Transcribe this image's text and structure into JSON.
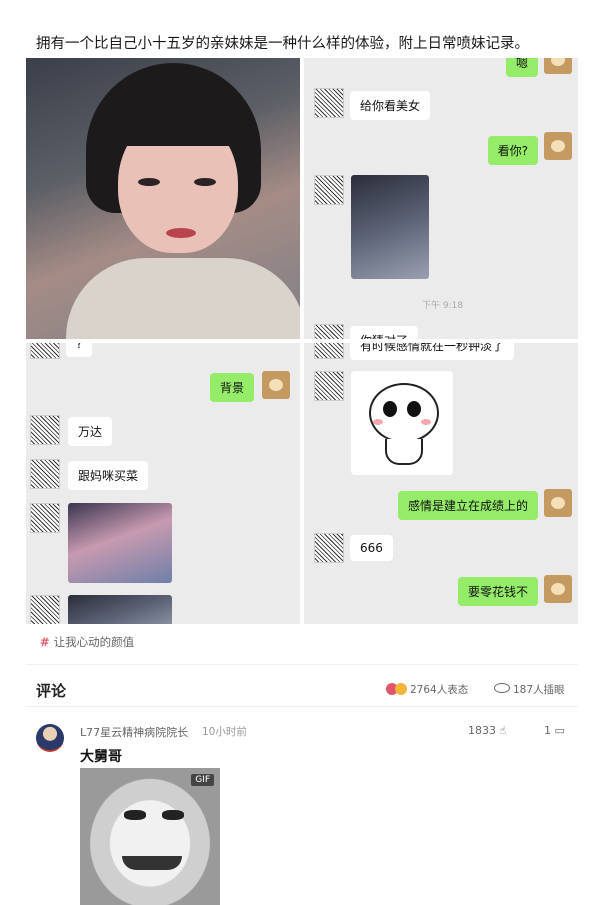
{
  "post": {
    "title": "拥有一个比自己小十五岁的亲妹妹是一种什么样的体验，附上日常喷妹记录。",
    "tag": "让我心动的颜值"
  },
  "chat1": {
    "top_bubble": "嗯",
    "left_1": "给你看美女",
    "right_1": "看你?",
    "timestamp": "下午 9:18",
    "cut_text": "你猜对了"
  },
  "chat2": {
    "top_cut": "?",
    "right_1": "背景",
    "left_1": "万达",
    "left_2": "跟妈咪买菜"
  },
  "chat3": {
    "top_cut": "有时候感情就在一秒钟淡了",
    "right_1": "感情是建立在成绩上的",
    "left_1": "666",
    "right_2": "要零花钱不"
  },
  "comments": {
    "header": "评论",
    "stat_agree": "2764人表态",
    "stat_view": "187人插眼",
    "items": [
      {
        "user": "L77星云精神病院院长",
        "time": "10小时前",
        "likes": "1833",
        "replies": "1",
        "text": "大舅哥",
        "gif_badge": "GIF"
      }
    ]
  },
  "colors": {
    "wechat_green": "#95ec69",
    "chat_bg": "#ebebeb",
    "tag_hash": "#e05a6a"
  }
}
